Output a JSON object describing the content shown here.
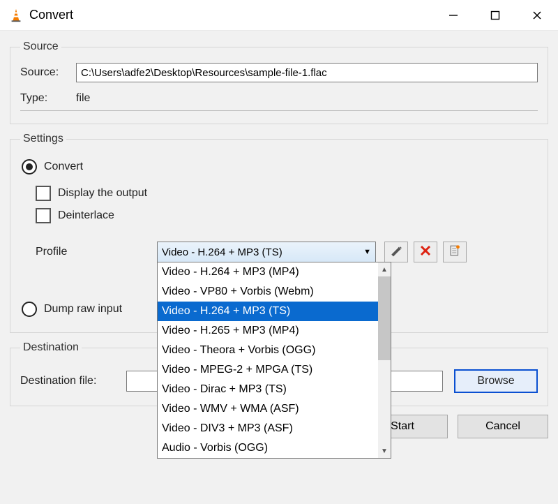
{
  "window": {
    "title": "Convert"
  },
  "source": {
    "legend": "Source",
    "source_label": "Source:",
    "source_value": "C:\\Users\\adfe2\\Desktop\\Resources\\sample-file-1.flac",
    "type_label": "Type:",
    "type_value": "file"
  },
  "settings": {
    "legend": "Settings",
    "convert_label": "Convert",
    "display_output_label": "Display the output",
    "deinterlace_label": "Deinterlace",
    "profile_label": "Profile",
    "profile_selected": "Video - H.264 + MP3 (TS)",
    "profile_options": [
      "Video - H.264 + MP3 (MP4)",
      "Video - VP80 + Vorbis (Webm)",
      "Video - H.264 + MP3 (TS)",
      "Video - H.265 + MP3 (MP4)",
      "Video - Theora + Vorbis (OGG)",
      "Video - MPEG-2 + MPGA (TS)",
      "Video - Dirac + MP3 (TS)",
      "Video - WMV + WMA (ASF)",
      "Video - DIV3 + MP3 (ASF)",
      "Audio - Vorbis (OGG)"
    ],
    "dump_raw_label": "Dump raw input"
  },
  "destination": {
    "legend": "Destination",
    "dest_file_label": "Destination file:",
    "browse_label": "Browse"
  },
  "buttons": {
    "start": "Start",
    "cancel": "Cancel"
  }
}
